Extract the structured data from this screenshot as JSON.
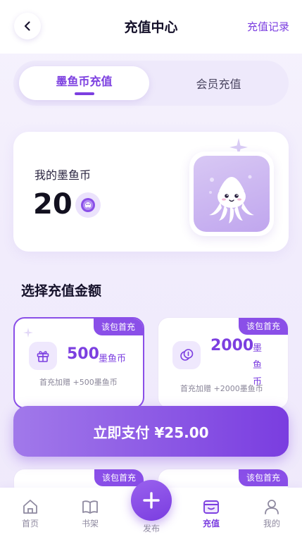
{
  "header": {
    "title": "充值中心",
    "history_link": "充值记录",
    "back_icon": "chevron-left-icon"
  },
  "tabs": [
    {
      "label": "墨鱼币充值",
      "active": true
    },
    {
      "label": "会员充值",
      "active": false
    }
  ],
  "balance": {
    "label": "我的墨鱼币",
    "value": "20",
    "coin_icon": "squid-coin-icon",
    "mascot_icon": "squid-mascot-icon"
  },
  "section_title": "选择充值金额",
  "packages": [
    {
      "badge": "该包首充",
      "amount": "500",
      "unit": "墨鱼币",
      "bonus": "首充加赠 +500墨鱼币",
      "icon": "gift-icon",
      "selected": true
    },
    {
      "badge": "该包首充",
      "amount": "2000",
      "unit": "墨鱼币",
      "bonus": "首充加赠 +2000墨鱼币",
      "icon": "coins-icon",
      "selected": false
    },
    {
      "badge": "该包首充",
      "selected": false
    },
    {
      "badge": "该包首充",
      "selected": false
    }
  ],
  "pay_button": "立即支付 ¥25.00",
  "nav": [
    {
      "label": "首页",
      "icon": "home-icon",
      "active": false
    },
    {
      "label": "书架",
      "icon": "book-icon",
      "active": false
    },
    {
      "label": "发布",
      "icon": "plus-icon",
      "active": false
    },
    {
      "label": "充值",
      "icon": "wallet-icon",
      "active": true
    },
    {
      "label": "我的",
      "icon": "user-icon",
      "active": false
    }
  ],
  "colors": {
    "accent": "#7c3fe0",
    "badge": "#8a4fe8",
    "background": "#f1ecfc"
  }
}
